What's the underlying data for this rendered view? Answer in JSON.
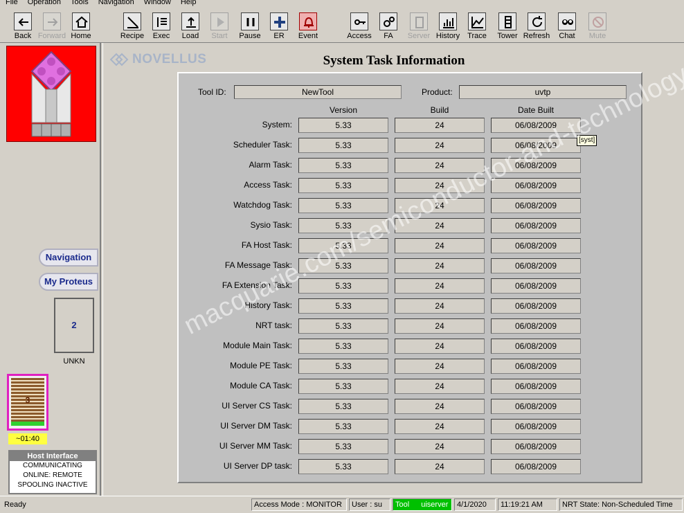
{
  "menu": [
    "File",
    "Operation",
    "Tools",
    "Navigation",
    "Window",
    "Help"
  ],
  "toolbar": [
    {
      "label": "Back",
      "icon": "back-arrow-icon",
      "enabled": true
    },
    {
      "label": "Forward",
      "icon": "forward-arrow-icon",
      "enabled": false
    },
    {
      "label": "Home",
      "icon": "home-icon",
      "enabled": true
    },
    {
      "label": "Recipe",
      "icon": "recipe-icon",
      "enabled": true
    },
    {
      "label": "Exec",
      "icon": "exec-icon",
      "enabled": true
    },
    {
      "label": "Load",
      "icon": "load-icon",
      "enabled": true
    },
    {
      "label": "Start",
      "icon": "play-icon",
      "enabled": false
    },
    {
      "label": "Pause",
      "icon": "pause-icon",
      "enabled": true
    },
    {
      "label": "ER",
      "icon": "plus-icon",
      "enabled": true
    },
    {
      "label": "Event",
      "icon": "bell-icon",
      "enabled": true
    },
    {
      "label": "Access",
      "icon": "key-icon",
      "enabled": true
    },
    {
      "label": "FA",
      "icon": "gears-icon",
      "enabled": true
    },
    {
      "label": "Server",
      "icon": "server-icon",
      "enabled": false
    },
    {
      "label": "History",
      "icon": "history-chart-icon",
      "enabled": true
    },
    {
      "label": "Trace",
      "icon": "trace-chart-icon",
      "enabled": true
    },
    {
      "label": "Tower",
      "icon": "tower-icon",
      "enabled": true
    },
    {
      "label": "Refresh",
      "icon": "refresh-icon",
      "enabled": true
    },
    {
      "label": "Chat",
      "icon": "chat-icon",
      "enabled": true
    },
    {
      "label": "Mute",
      "icon": "mute-icon",
      "enabled": false
    }
  ],
  "left": {
    "nav_label": "Navigation",
    "proteus_label": "My Proteus",
    "module_number": "2",
    "module_state": "UNKN",
    "cassette_number": "3",
    "timer": "~01:40",
    "host_interface": {
      "title": "Host Interface",
      "lines": [
        "COMMUNICATING",
        "ONLINE: REMOTE",
        "SPOOLING INACTIVE"
      ]
    }
  },
  "main": {
    "logo_text": "NOVELLUS",
    "title": "System Task Information",
    "tool_id_label": "Tool ID:",
    "tool_id": "NewTool",
    "product_label": "Product:",
    "product": "uvtp",
    "columns": [
      "Version",
      "Build",
      "Date Built"
    ],
    "tooltip": "[syst]",
    "watermark": "macquarie.com/semiconductor-and-technology",
    "rows": [
      {
        "name": "System:",
        "version": "5.33",
        "build": "24",
        "date": "06/08/2009"
      },
      {
        "name": "Scheduler Task:",
        "version": "5.33",
        "build": "24",
        "date": "06/08/2009"
      },
      {
        "name": "Alarm Task:",
        "version": "5.33",
        "build": "24",
        "date": "06/08/2009"
      },
      {
        "name": "Access Task:",
        "version": "5.33",
        "build": "24",
        "date": "06/08/2009"
      },
      {
        "name": "Watchdog Task:",
        "version": "5.33",
        "build": "24",
        "date": "06/08/2009"
      },
      {
        "name": "Sysio Task:",
        "version": "5.33",
        "build": "24",
        "date": "06/08/2009"
      },
      {
        "name": "FA Host Task:",
        "version": "5.33",
        "build": "24",
        "date": "06/08/2009"
      },
      {
        "name": "FA Message Task:",
        "version": "5.33",
        "build": "24",
        "date": "06/08/2009"
      },
      {
        "name": "FA Extension Task:",
        "version": "5.33",
        "build": "24",
        "date": "06/08/2009"
      },
      {
        "name": "History Task:",
        "version": "5.33",
        "build": "24",
        "date": "06/08/2009"
      },
      {
        "name": "NRT task:",
        "version": "5.33",
        "build": "24",
        "date": "06/08/2009"
      },
      {
        "name": "Module Main Task:",
        "version": "5.33",
        "build": "24",
        "date": "06/08/2009"
      },
      {
        "name": "Module PE Task:",
        "version": "5.33",
        "build": "24",
        "date": "06/08/2009"
      },
      {
        "name": "Module CA Task:",
        "version": "5.33",
        "build": "24",
        "date": "06/08/2009"
      },
      {
        "name": "UI Server CS Task:",
        "version": "5.33",
        "build": "24",
        "date": "06/08/2009"
      },
      {
        "name": "UI Server DM Task:",
        "version": "5.33",
        "build": "24",
        "date": "06/08/2009"
      },
      {
        "name": "UI Server MM Task:",
        "version": "5.33",
        "build": "24",
        "date": "06/08/2009"
      },
      {
        "name": "UI Server DP task:",
        "version": "5.33",
        "build": "24",
        "date": "06/08/2009"
      }
    ]
  },
  "status": {
    "ready": "Ready",
    "access_mode": "Access Mode : MONITOR",
    "user": "User :  su",
    "tool_label": "Tool",
    "tool_server": "uiserver",
    "date": "4/1/2020",
    "time": "11:19:21 AM",
    "nrt_state": "NRT State: Non-Scheduled Time"
  },
  "colors": {
    "tool_graphic_bg": "#ff0000",
    "status_tool_bg": "#00c000",
    "timer_bg": "#ffff40",
    "cassette_border": "#e020c0"
  }
}
